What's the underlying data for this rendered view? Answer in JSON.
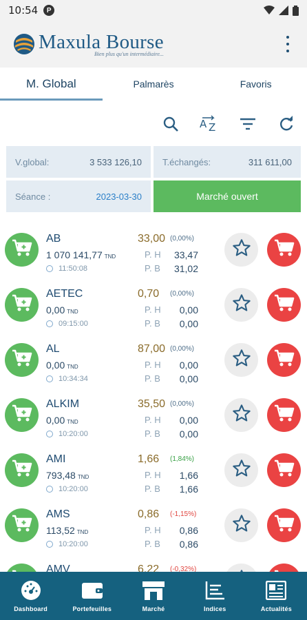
{
  "status": {
    "time": "10:54"
  },
  "app": {
    "title": "Maxula Bourse",
    "tagline": "Bien plus qu'un intermédiaire..."
  },
  "tabs": [
    {
      "label": "M. Global",
      "active": true
    },
    {
      "label": "Palmarès",
      "active": false
    },
    {
      "label": "Favoris",
      "active": false
    }
  ],
  "toolbar": {
    "search_icon": "search-icon",
    "sort_icon": "sort-az-icon",
    "filter_icon": "filter-icon",
    "refresh_icon": "refresh-icon"
  },
  "summary": {
    "vglobal_label": "V.global:",
    "vglobal_value": "3 533 126,10",
    "techanges_label": "T.échangés:",
    "techanges_value": "311 611,00",
    "seance_label": "Séance :",
    "seance_value": "2023-03-30",
    "market_status": "Marché ouvert"
  },
  "labels": {
    "ph": "P. H",
    "pb": "P. B",
    "currency": "TND"
  },
  "stocks": [
    {
      "symbol": "AB",
      "volume": "1 070 141,77",
      "time": "11:50:08",
      "price": "33,00",
      "change": "(0,00%)",
      "trend": "flat",
      "ph": "33,47",
      "pb": "31,02"
    },
    {
      "symbol": "AETEC",
      "volume": "0,00",
      "time": "09:15:00",
      "price": "0,70",
      "change": "(0,00%)",
      "trend": "flat",
      "ph": "0,00",
      "pb": "0,00"
    },
    {
      "symbol": "AL",
      "volume": "0,00",
      "time": "10:34:34",
      "price": "87,00",
      "change": "(0,00%)",
      "trend": "flat",
      "ph": "0,00",
      "pb": "0,00"
    },
    {
      "symbol": "ALKIM",
      "volume": "0,00",
      "time": "10:20:00",
      "price": "35,50",
      "change": "(0,00%)",
      "trend": "flat",
      "ph": "0,00",
      "pb": "0,00"
    },
    {
      "symbol": "AMI",
      "volume": "793,48",
      "time": "10:20:00",
      "price": "1,66",
      "change": "(1,84%)",
      "trend": "up",
      "ph": "1,66",
      "pb": "1,66"
    },
    {
      "symbol": "AMS",
      "volume": "113,52",
      "time": "10:20:00",
      "price": "0,86",
      "change": "(-1,15%)",
      "trend": "down",
      "ph": "0,86",
      "pb": "0,86"
    },
    {
      "symbol": "AMV",
      "volume": "",
      "time": "",
      "price": "6,22",
      "change": "(-0,32%)",
      "trend": "down",
      "ph": "",
      "pb": ""
    }
  ],
  "bottom_nav": [
    {
      "label": "Dashboard",
      "icon": "dashboard-icon"
    },
    {
      "label": "Portefeuilles",
      "icon": "wallet-icon"
    },
    {
      "label": "Marché",
      "icon": "market-icon"
    },
    {
      "label": "Indices",
      "icon": "indices-icon"
    },
    {
      "label": "Actualités",
      "icon": "news-icon"
    }
  ],
  "colors": {
    "primary": "#15617f",
    "buy": "#5cba5f",
    "sell": "#ea4343",
    "up": "#38a045",
    "down": "#e0443e"
  }
}
